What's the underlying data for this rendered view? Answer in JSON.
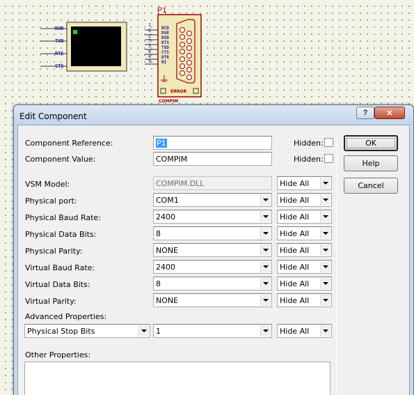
{
  "schematic": {
    "terminal": {
      "pins": [
        "RXD",
        "TXD",
        "RTS",
        "CTS"
      ]
    },
    "compim": {
      "ref": "P1",
      "pin_numbers": [
        "1",
        "6",
        "2",
        "7",
        "3",
        "8",
        "4",
        "9"
      ],
      "pin_labels": [
        "DCD",
        "DSR",
        "RXD",
        "RTS",
        "TXD",
        "CTS",
        "DTR",
        "RI"
      ],
      "error_label": "ERROR",
      "part_label": "COMPIM"
    }
  },
  "dialog": {
    "title": "Edit Component",
    "help_glyph": "?",
    "close_glyph": "✕",
    "buttons": {
      "ok": "OK",
      "help": "Help",
      "cancel": "Cancel"
    },
    "component_reference": {
      "label": "Component Reference:",
      "value": "P1",
      "hidden_label": "Hidden:"
    },
    "component_value": {
      "label": "Component Value:",
      "value": "COMPIM",
      "hidden_label": "Hidden:"
    },
    "properties": [
      {
        "label": "VSM Model:",
        "value": "COMPIM.DLL",
        "kind": "text-disabled",
        "visibility": "Hide All"
      },
      {
        "label": "Physical port:",
        "value": "COM1",
        "kind": "combo",
        "visibility": "Hide All"
      },
      {
        "label": "Physical Baud Rate:",
        "value": "2400",
        "kind": "combo",
        "visibility": "Hide All"
      },
      {
        "label": "Physical Data Bits:",
        "value": "8",
        "kind": "combo",
        "visibility": "Hide All"
      },
      {
        "label": "Physical Parity:",
        "value": "NONE",
        "kind": "combo",
        "visibility": "Hide All"
      },
      {
        "label": "Virtual Baud Rate:",
        "value": "2400",
        "kind": "combo",
        "visibility": "Hide All"
      },
      {
        "label": "Virtual Data Bits:",
        "value": "8",
        "kind": "combo",
        "visibility": "Hide All"
      },
      {
        "label": "Virtual Parity:",
        "value": "NONE",
        "kind": "combo",
        "visibility": "Hide All"
      }
    ],
    "advanced": {
      "label": "Advanced Properties:",
      "property": "Physical Stop Bits",
      "value": "1",
      "visibility": "Hide All"
    },
    "other_properties": {
      "label": "Other Properties:",
      "value": ""
    }
  },
  "colors": {
    "pin_text": "#1a1aa0",
    "part_outline": "#a00000",
    "selection": "#3399ff"
  }
}
